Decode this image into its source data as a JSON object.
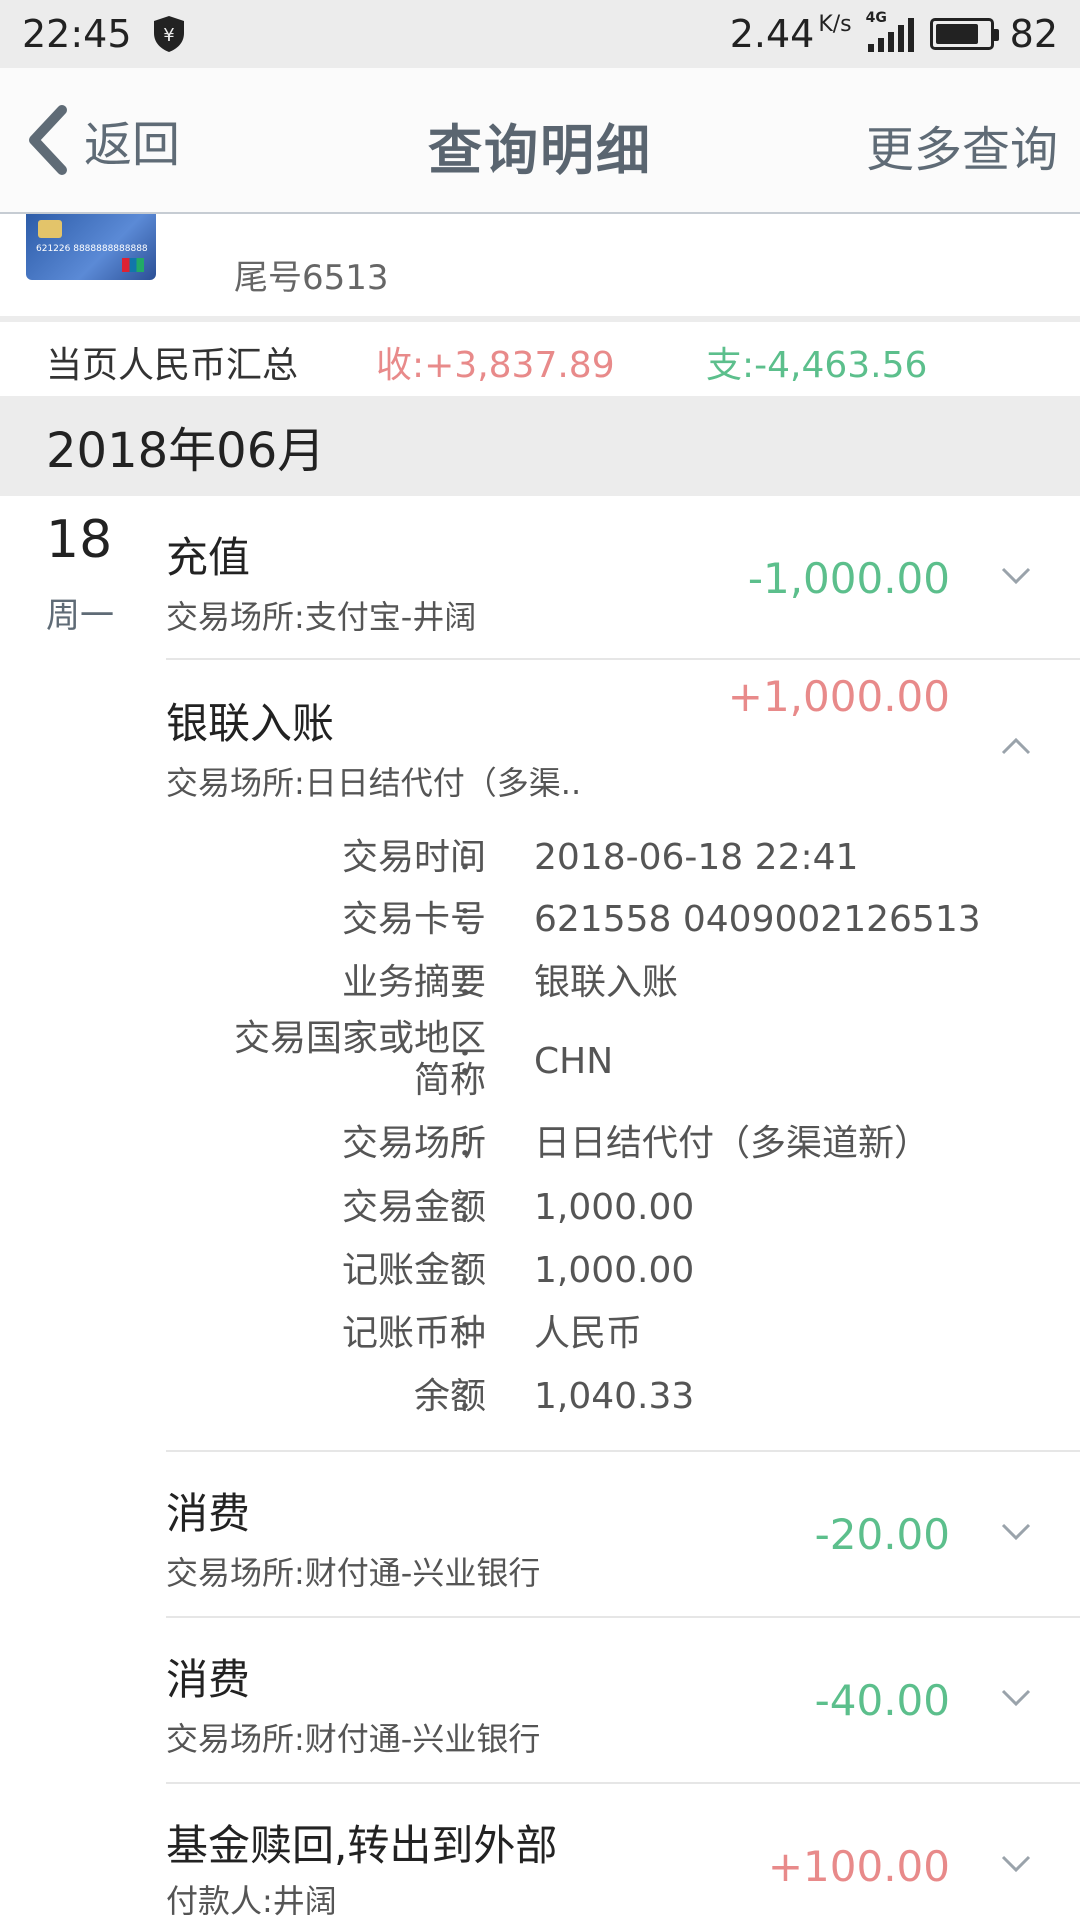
{
  "status_bar": {
    "time": "22:45",
    "net_speed": "2.44",
    "net_unit": "K/s",
    "signal_tag": "4G",
    "battery": "82",
    "battery_level": 0.82
  },
  "nav": {
    "back_label": "返回",
    "title": "查询明细",
    "more_label": "更多查询"
  },
  "card": {
    "tail_label": "尾号6513",
    "card_number_text": "621226 8888888888888"
  },
  "summary": {
    "label": "当页人民币汇总",
    "income": "收:+3,837.89",
    "expense": "支:-4,463.56"
  },
  "month": "2018年06月",
  "day": {
    "number": "18",
    "weekday": "周一"
  },
  "transactions": [
    {
      "title": "充值",
      "subtitle": "交易场所:支付宝-井阔",
      "amount": "-1,000.00"
    },
    {
      "title": "银联入账",
      "subtitle": "交易场所:日日结代付（多渠..",
      "amount": "+1,000.00"
    },
    {
      "title": "消费",
      "subtitle": "交易场所:财付通-兴业银行",
      "amount": "-20.00"
    },
    {
      "title": "消费",
      "subtitle": "交易场所:财付通-兴业银行",
      "amount": "-40.00"
    },
    {
      "title": "基金赎回,转出到外部",
      "subtitle": "付款人:井阔",
      "amount": "+100.00"
    }
  ],
  "detail": {
    "colon": "：",
    "rows": [
      {
        "label": "交易时间",
        "value": "2018-06-18 22:41"
      },
      {
        "label": "交易卡号",
        "value": "621558 0409002126513"
      },
      {
        "label": "业务摘要",
        "value": "银联入账"
      },
      {
        "label_line1": "交易国家或地区",
        "label_line2": "简称",
        "value": "CHN"
      },
      {
        "label": "交易场所",
        "value": "日日结代付（多渠道新）"
      },
      {
        "label": "交易金额",
        "value": "1,000.00"
      },
      {
        "label": "记账金额",
        "value": "1,000.00"
      },
      {
        "label": "记账币种",
        "value": "人民币"
      },
      {
        "label": "余额",
        "value": "1,040.33"
      }
    ]
  },
  "colors": {
    "income": "#e88a8a",
    "expense": "#5cbf8c",
    "nav_text": "#5f6b76"
  }
}
